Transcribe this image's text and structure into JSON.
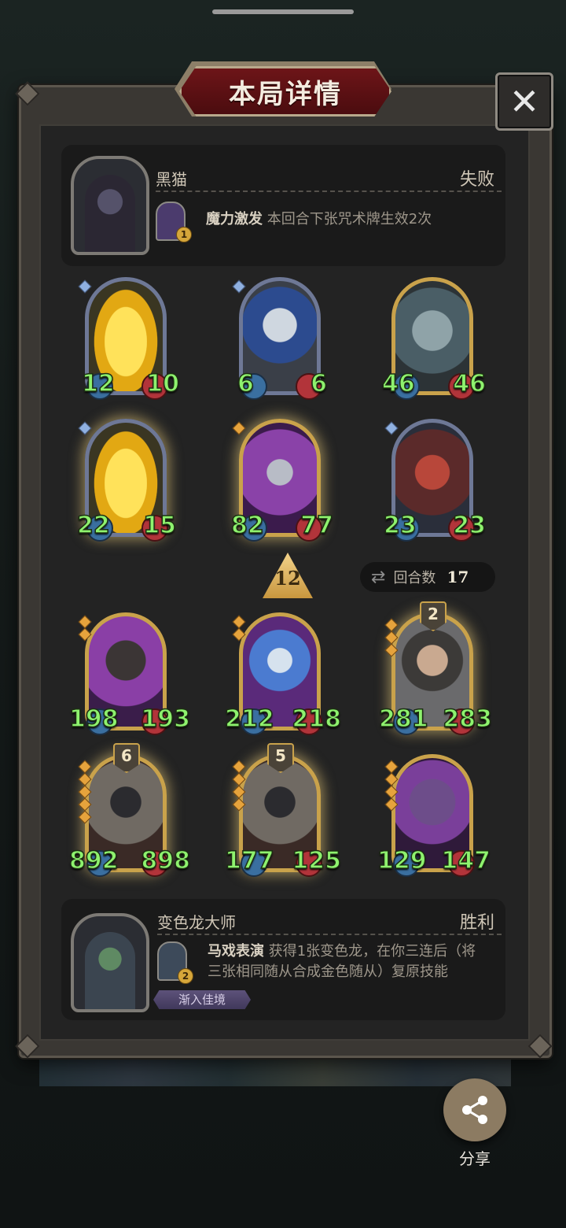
{
  "header": {
    "title": "本局详情",
    "close_icon": "close-icon"
  },
  "player": {
    "name": "黑猫",
    "result": "失败",
    "skill": {
      "title": "魔力激发",
      "description": "本回合下张咒术牌生效2次",
      "badge": "1"
    }
  },
  "player_minions": [
    {
      "atk": "12",
      "hp": "10",
      "frame": "normal"
    },
    {
      "atk": "6",
      "hp": "6",
      "frame": "normal"
    },
    {
      "atk": "46",
      "hp": "46",
      "frame": "gold"
    },
    {
      "atk": "22",
      "hp": "15",
      "frame": "normal"
    },
    {
      "atk": "82",
      "hp": "77",
      "frame": "gold"
    },
    {
      "atk": "23",
      "hp": "23",
      "frame": "normal"
    }
  ],
  "level_badge": "12",
  "turns": {
    "label": "回合数",
    "value": "17"
  },
  "opponent_minions": [
    {
      "atk": "198",
      "hp": "193",
      "frame": "gold"
    },
    {
      "atk": "212",
      "hp": "218",
      "frame": "gold"
    },
    {
      "atk": "281",
      "hp": "283",
      "frame": "gold",
      "golden_count": "2"
    },
    {
      "atk": "892",
      "hp": "898",
      "frame": "gold",
      "golden_count": "6"
    },
    {
      "atk": "177",
      "hp": "125",
      "frame": "gold",
      "golden_count": "5"
    },
    {
      "atk": "129",
      "hp": "147",
      "frame": "gold"
    }
  ],
  "opponent": {
    "name": "变色龙大师",
    "result": "胜利",
    "skill": {
      "title": "马戏表演",
      "description_line1": "获得1张变色龙，在你三连后（将",
      "description_line2": "三张相同随从合成金色随从）复原技能",
      "badge": "2"
    },
    "trophy": "渐入佳境"
  },
  "share": {
    "label": "分享"
  }
}
